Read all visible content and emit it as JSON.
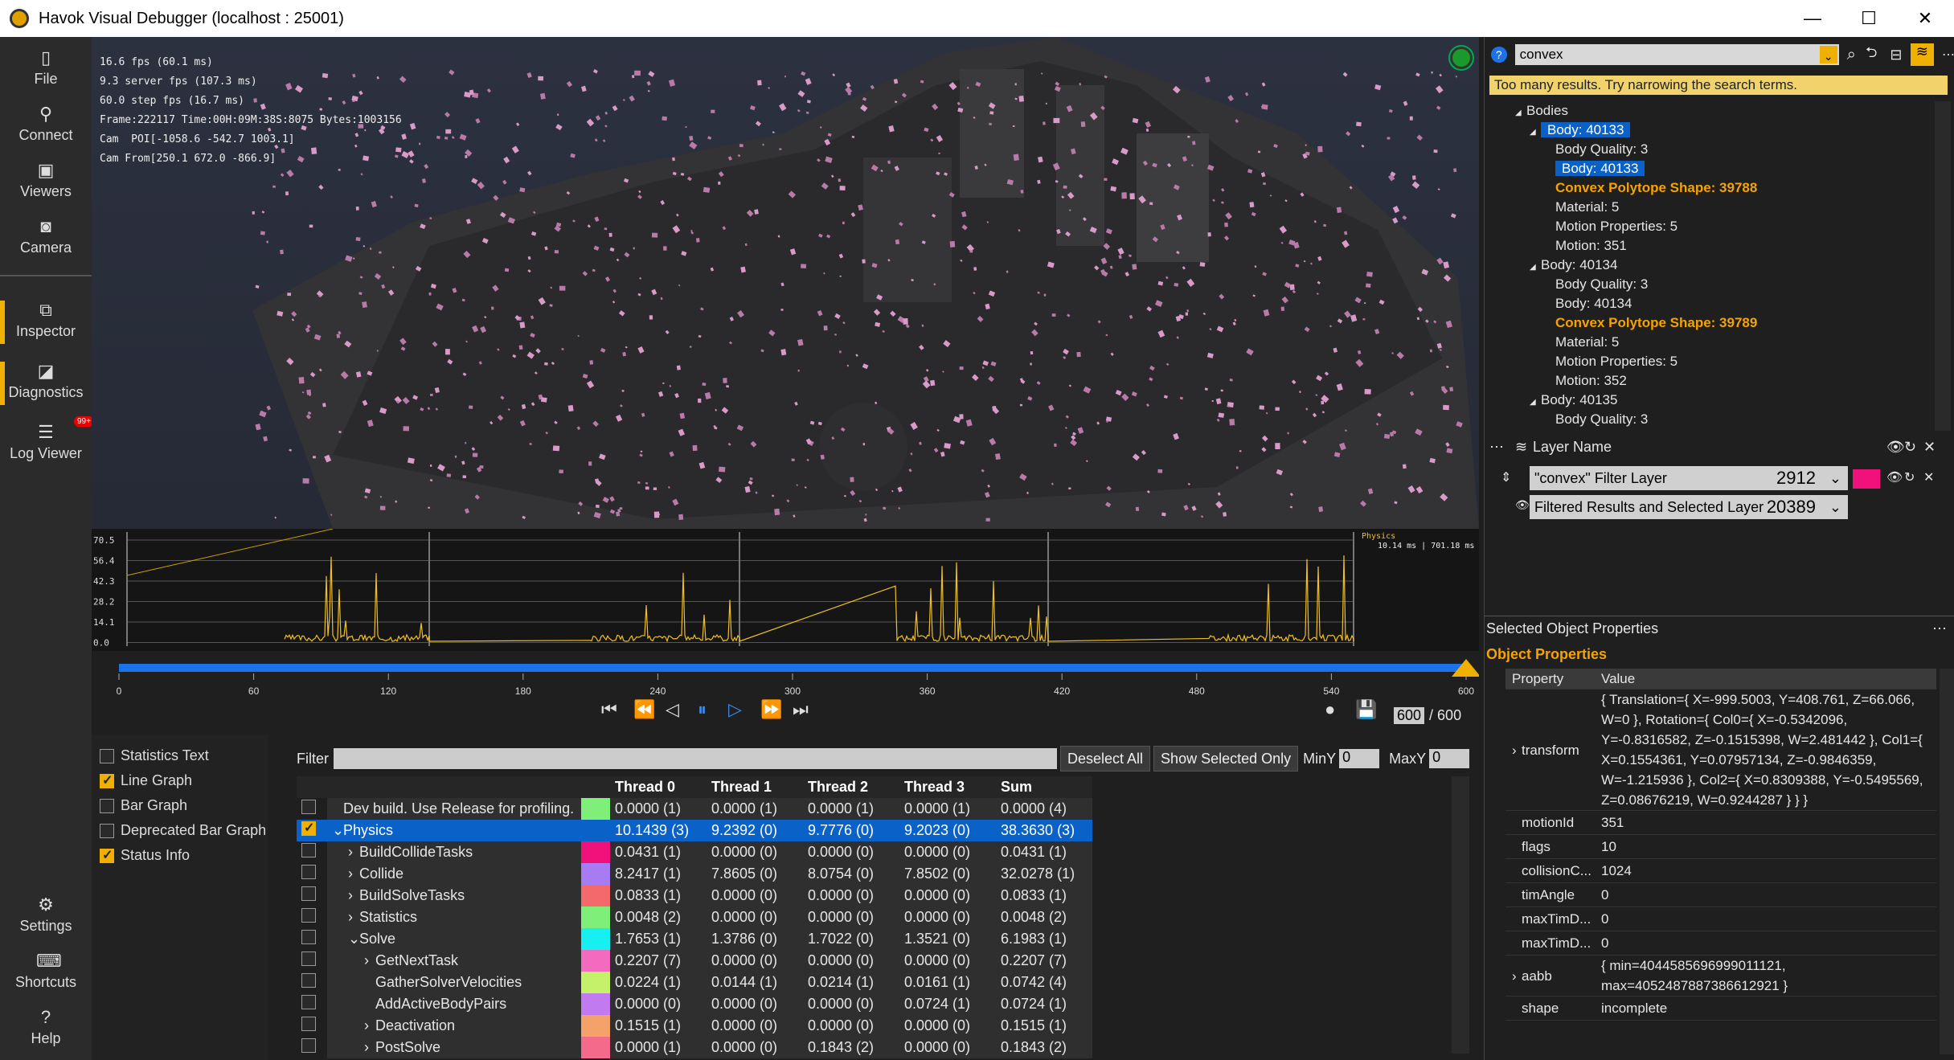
{
  "window": {
    "title": "Havok Visual Debugger  (localhost : 25001)",
    "minimize": "—",
    "maximize": "☐",
    "close": "✕"
  },
  "nav": {
    "items": [
      {
        "label": "File",
        "icon": "file-icon"
      },
      {
        "label": "Connect",
        "icon": "connect-icon"
      },
      {
        "label": "Viewers",
        "icon": "viewers-icon"
      },
      {
        "label": "Camera",
        "icon": "camera-icon"
      },
      {
        "label": "Inspector",
        "icon": "inspector-icon"
      },
      {
        "label": "Diagnostics",
        "icon": "diagnostics-icon"
      },
      {
        "label": "Log Viewer",
        "icon": "log-icon"
      },
      {
        "label": "Settings",
        "icon": "gear-icon"
      },
      {
        "label": "Shortcuts",
        "icon": "keyboard-icon"
      },
      {
        "label": "Help",
        "icon": "help-icon"
      }
    ],
    "log_badge": "99+"
  },
  "hud": {
    "lines": [
      "16.6 fps (60.1 ms)",
      "9.3 server fps (107.3 ms)",
      "60.0 step fps (16.7 ms)",
      "Frame:222117 Time:00H:09M:38S:8075 Bytes:1003156",
      "Cam  POI[-1058.6 -542.7 1003.1]",
      "Cam From[250.1 672.0 -866.9]"
    ]
  },
  "graph": {
    "yticks": [
      "70.5",
      "56.4",
      "42.3",
      "28.2",
      "14.1",
      "0.0"
    ],
    "label": "Physics",
    "readout": "10.14 ms | 701.18 ms"
  },
  "timeline": {
    "ticks": [
      "0",
      "60",
      "120",
      "180",
      "240",
      "300",
      "360",
      "420",
      "480",
      "540",
      "600"
    ],
    "frame": "600",
    "total": "/ 600"
  },
  "checks": [
    {
      "label": "Statistics Text",
      "on": false
    },
    {
      "label": "Line Graph",
      "on": true
    },
    {
      "label": "Bar Graph",
      "on": false
    },
    {
      "label": "Deprecated Bar Graph",
      "on": false
    },
    {
      "label": "Status Info",
      "on": true
    }
  ],
  "filter": {
    "label": "Filter",
    "deselect": "Deselect All",
    "show_selected": "Show Selected Only",
    "miny_label": "MinY",
    "miny": "0",
    "maxy_label": "MaxY",
    "maxy": "0"
  },
  "stats": {
    "headers": [
      "Thread 0",
      "Thread 1",
      "Thread 2",
      "Thread 3",
      "Sum"
    ],
    "rows": [
      {
        "name": "Dev build. Use Release for profiling.",
        "indent": 0,
        "exp": "",
        "color": "#7ef07a",
        "v": [
          "0.0000 (1)",
          "0.0000 (1)",
          "0.0000 (1)",
          "0.0000 (1)",
          "0.0000 (4)"
        ],
        "sel": false
      },
      {
        "name": "Physics",
        "indent": 0,
        "exp": "v",
        "color": "#f2c31a",
        "v": [
          "10.1439 (3)",
          "9.2392 (0)",
          "9.7776 (0)",
          "9.2023 (0)",
          "38.3630 (3)"
        ],
        "sel": true
      },
      {
        "name": "BuildCollideTasks",
        "indent": 1,
        "exp": ">",
        "color": "#f0127a",
        "v": [
          "0.0431 (1)",
          "0.0000 (0)",
          "0.0000 (0)",
          "0.0000 (0)",
          "0.0431 (1)"
        ],
        "sel": false
      },
      {
        "name": "Collide",
        "indent": 1,
        "exp": ">",
        "color": "#a77cf2",
        "v": [
          "8.2417 (1)",
          "7.8605 (0)",
          "8.0754 (0)",
          "7.8502 (0)",
          "32.0278 (1)"
        ],
        "sel": false
      },
      {
        "name": "BuildSolveTasks",
        "indent": 1,
        "exp": ">",
        "color": "#f46a6a",
        "v": [
          "0.0833 (1)",
          "0.0000 (0)",
          "0.0000 (0)",
          "0.0000 (0)",
          "0.0833 (1)"
        ],
        "sel": false
      },
      {
        "name": "Statistics",
        "indent": 1,
        "exp": ">",
        "color": "#7ef07a",
        "v": [
          "0.0048 (2)",
          "0.0000 (0)",
          "0.0000 (0)",
          "0.0000 (0)",
          "0.0048 (2)"
        ],
        "sel": false
      },
      {
        "name": "Solve",
        "indent": 1,
        "exp": "v",
        "color": "#16f0f0",
        "v": [
          "1.7653 (1)",
          "1.3786 (0)",
          "1.7022 (0)",
          "1.3521 (0)",
          "6.1983 (1)"
        ],
        "sel": false
      },
      {
        "name": "GetNextTask",
        "indent": 2,
        "exp": ">",
        "color": "#f46abf",
        "v": [
          "0.2207 (7)",
          "0.0000 (0)",
          "0.0000 (0)",
          "0.0000 (0)",
          "0.2207 (7)"
        ],
        "sel": false
      },
      {
        "name": "GatherSolverVelocities",
        "indent": 2,
        "exp": "",
        "color": "#c4f06a",
        "v": [
          "0.0224 (1)",
          "0.0144 (1)",
          "0.0214 (1)",
          "0.0161 (1)",
          "0.0742 (4)"
        ],
        "sel": false
      },
      {
        "name": "AddActiveBodyPairs",
        "indent": 2,
        "exp": "",
        "color": "#c27af0",
        "v": [
          "0.0000 (0)",
          "0.0000 (0)",
          "0.0000 (0)",
          "0.0724 (1)",
          "0.0724 (1)"
        ],
        "sel": false
      },
      {
        "name": "Deactivation",
        "indent": 2,
        "exp": ">",
        "color": "#f4a26a",
        "v": [
          "0.1515 (1)",
          "0.0000 (0)",
          "0.0000 (0)",
          "0.0000 (0)",
          "0.1515 (1)"
        ],
        "sel": false
      },
      {
        "name": "PostSolve",
        "indent": 2,
        "exp": ">",
        "color": "#f46a8a",
        "v": [
          "0.0000 (1)",
          "0.0000 (0)",
          "0.1843 (2)",
          "0.0000 (0)",
          "0.1843 (2)"
        ],
        "sel": false
      }
    ]
  },
  "search": {
    "value": "convex",
    "warning": "Too many results.  Try narrowing the search terms."
  },
  "tree": [
    {
      "t": "Bodies",
      "i": 1,
      "cls": ""
    },
    {
      "t": "Body: 40133",
      "i": 2,
      "cls": "hl"
    },
    {
      "t": "Body Quality: 3",
      "i": 3,
      "cls": ""
    },
    {
      "t": "Body: 40133",
      "i": 3,
      "cls": "hl"
    },
    {
      "t": "Convex Polytope Shape: 39788",
      "i": 3,
      "cls": "orange"
    },
    {
      "t": "Material: 5",
      "i": 3,
      "cls": ""
    },
    {
      "t": "Motion Properties: 5",
      "i": 3,
      "cls": ""
    },
    {
      "t": "Motion: 351",
      "i": 3,
      "cls": ""
    },
    {
      "t": "Body: 40134",
      "i": 2,
      "cls": ""
    },
    {
      "t": "Body Quality: 3",
      "i": 3,
      "cls": ""
    },
    {
      "t": "Body: 40134",
      "i": 3,
      "cls": ""
    },
    {
      "t": "Convex Polytope Shape: 39789",
      "i": 3,
      "cls": "orange"
    },
    {
      "t": "Material: 5",
      "i": 3,
      "cls": ""
    },
    {
      "t": "Motion Properties: 5",
      "i": 3,
      "cls": ""
    },
    {
      "t": "Motion: 352",
      "i": 3,
      "cls": ""
    },
    {
      "t": "Body: 40135",
      "i": 2,
      "cls": ""
    },
    {
      "t": "Body Quality: 3",
      "i": 3,
      "cls": ""
    }
  ],
  "layers": {
    "header": "Layer Name",
    "rows": [
      {
        "name": "\"convex\" Filter Layer",
        "count": "2912",
        "color": "#f0127a"
      },
      {
        "name": "Filtered Results and Selected Layer",
        "count": "20389"
      }
    ]
  },
  "props": {
    "section": "Selected Object Properties",
    "title": "Object Properties",
    "col_prop": "Property",
    "col_val": "Value",
    "rows": [
      {
        "k": "transform",
        "v": "{ Translation={ X=-999.5003, Y=408.761, Z=66.066, W=0 }, Rotation={ Col0={ X=-0.5342096, Y=-0.8316582, Z=-0.1515398, W=2.481442 }, Col1={ X=0.1554361, Y=0.07957134, Z=-0.9846359, W=-1.215936 }, Col2={ X=0.8309388, Y=-0.5495569, Z=0.08676219, W=0.9244287 } } }",
        "exp": true
      },
      {
        "k": "motionId",
        "v": "351"
      },
      {
        "k": "flags",
        "v": "10"
      },
      {
        "k": "collisionC...",
        "v": "1024"
      },
      {
        "k": "timAngle",
        "v": "0"
      },
      {
        "k": "maxTimD...",
        "v": "0"
      },
      {
        "k": "maxTimD...",
        "v": "0"
      },
      {
        "k": "aabb",
        "v": "{ min=4044585696999011121, max=4052487887386612921 }",
        "exp": true
      },
      {
        "k": "shape",
        "v": "incomplete"
      }
    ]
  }
}
